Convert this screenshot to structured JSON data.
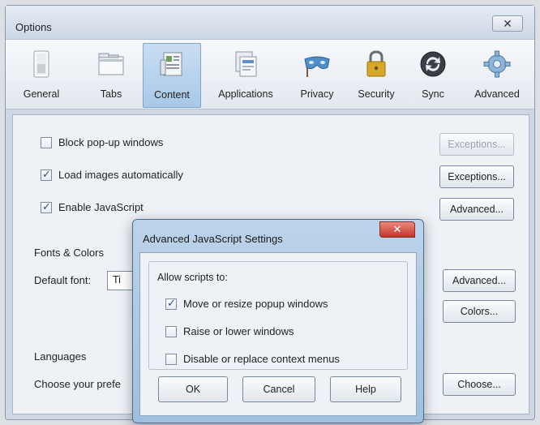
{
  "options": {
    "title": "Options",
    "close_glyph": "✕",
    "tabs": [
      {
        "label": "General",
        "icon": "switch-icon"
      },
      {
        "label": "Tabs",
        "icon": "tabs-window-icon"
      },
      {
        "label": "Content",
        "icon": "content-page-icon"
      },
      {
        "label": "Applications",
        "icon": "applications-icon"
      },
      {
        "label": "Privacy",
        "icon": "privacy-mask-icon"
      },
      {
        "label": "Security",
        "icon": "padlock-icon"
      },
      {
        "label": "Sync",
        "icon": "sync-icon"
      },
      {
        "label": "Advanced",
        "icon": "gear-icon"
      }
    ],
    "active_tab": "Content",
    "content": {
      "block_popups": {
        "label": "Block pop-up windows",
        "checked": false
      },
      "load_images": {
        "label": "Load images automatically",
        "checked": true
      },
      "enable_js": {
        "label": "Enable JavaScript",
        "checked": true
      },
      "exceptions_disabled": "Exceptions...",
      "exceptions": "Exceptions...",
      "advanced_js": "Advanced...",
      "fonts_heading": "Fonts & Colors",
      "default_font_label": "Default font:",
      "default_font_value": "Ti",
      "advanced_fonts": "Advanced...",
      "colors": "Colors...",
      "languages_heading": "Languages",
      "languages_text": "Choose your prefe",
      "choose": "Choose..."
    }
  },
  "dialog": {
    "title": "Advanced JavaScript Settings",
    "close_glyph": "✕",
    "group_label": "Allow scripts to:",
    "options": [
      {
        "label": "Move or resize popup windows",
        "checked": true
      },
      {
        "label": "Raise or lower windows",
        "checked": false
      },
      {
        "label": "Disable or replace context menus",
        "checked": false
      }
    ],
    "ok": "OK",
    "cancel": "Cancel",
    "help": "Help"
  },
  "colors": {
    "active_tab_bg": "#a8c8e8",
    "close_red": "#c4372a",
    "dialog_frame": "#9fbfdf"
  }
}
